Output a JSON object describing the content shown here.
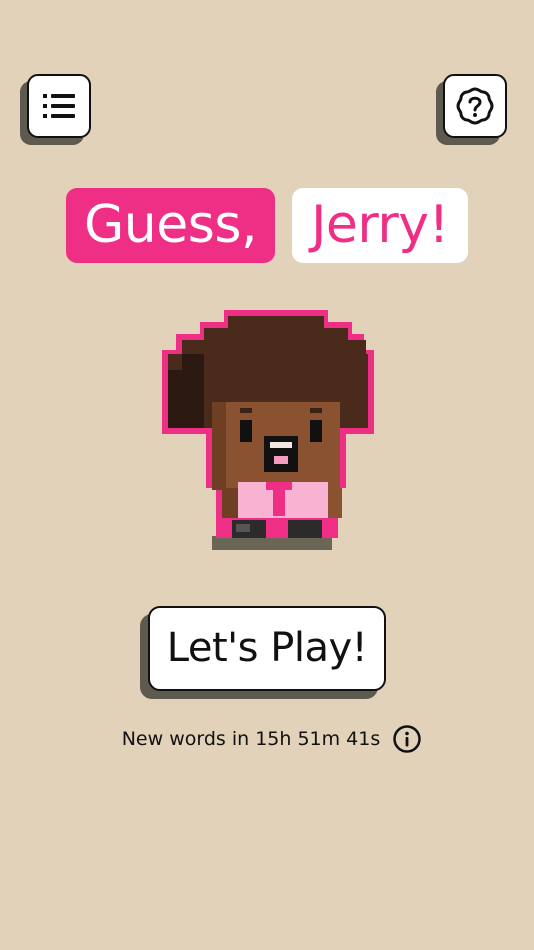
{
  "title": {
    "word1": "Guess,",
    "word2": "Jerry!"
  },
  "menu_button": {
    "icon": "list-icon"
  },
  "help_button": {
    "icon": "help-badge-icon"
  },
  "play_button": {
    "label": "Let's Play!"
  },
  "countdown": {
    "text": "New words in 15h 51m 41s",
    "info_icon": "info-icon"
  },
  "colors": {
    "background": "#e2d2b9",
    "accent_pink": "#ef2e86",
    "button_shadow": "#5e5a4f"
  }
}
